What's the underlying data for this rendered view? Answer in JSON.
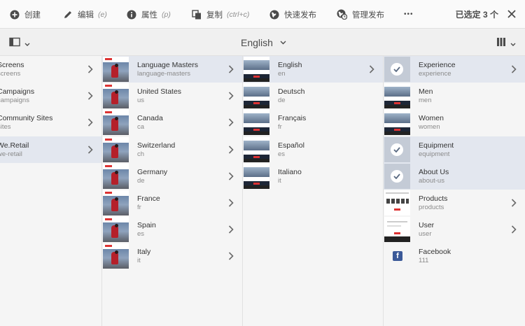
{
  "actionbar": {
    "create_label": "创建",
    "edit_label": "编辑",
    "edit_hint": "(e)",
    "properties_label": "属性",
    "properties_hint": "(p)",
    "copy_label": "复制",
    "copy_hint": "(ctrl+c)",
    "quick_publish_label": "快速发布",
    "manage_publish_label": "管理发布",
    "more_label": "•••",
    "selection_count": "已选定 3 个"
  },
  "titlebar": {
    "title": "English"
  },
  "columns": {
    "col1": [
      {
        "label": "Screens",
        "sub": "screens",
        "active": false
      },
      {
        "label": "Campaigns",
        "sub": "campaigns",
        "active": false
      },
      {
        "label": "Community Sites",
        "sub": "sites",
        "active": false
      },
      {
        "label": "We.Retail",
        "sub": "we-retail",
        "active": true
      }
    ],
    "col2": [
      {
        "label": "Language Masters",
        "sub": "language-masters",
        "active": true
      },
      {
        "label": "United States",
        "sub": "us",
        "active": false
      },
      {
        "label": "Canada",
        "sub": "ca",
        "active": false
      },
      {
        "label": "Switzerland",
        "sub": "ch",
        "active": false
      },
      {
        "label": "Germany",
        "sub": "de",
        "active": false
      },
      {
        "label": "France",
        "sub": "fr",
        "active": false
      },
      {
        "label": "Spain",
        "sub": "es",
        "active": false
      },
      {
        "label": "Italy",
        "sub": "it",
        "active": false
      }
    ],
    "col3": [
      {
        "label": "English",
        "sub": "en",
        "active": true
      },
      {
        "label": "Deutsch",
        "sub": "de",
        "active": false
      },
      {
        "label": "Français",
        "sub": "fr",
        "active": false
      },
      {
        "label": "Español",
        "sub": "es",
        "active": false
      },
      {
        "label": "Italiano",
        "sub": "it",
        "active": false
      }
    ],
    "col4": [
      {
        "label": "Experience",
        "sub": "experience",
        "active": true,
        "selected": true
      },
      {
        "label": "Men",
        "sub": "men",
        "active": false
      },
      {
        "label": "Women",
        "sub": "women",
        "active": false
      },
      {
        "label": "Equipment",
        "sub": "equipment",
        "active": true,
        "selected": true
      },
      {
        "label": "About Us",
        "sub": "about-us",
        "active": true,
        "selected": true
      },
      {
        "label": "Products",
        "sub": "products",
        "active": false
      },
      {
        "label": "User",
        "sub": "user",
        "active": false
      },
      {
        "label": "Facebook",
        "sub": "111",
        "active": false
      }
    ]
  },
  "icons": {
    "create": "add-circle-icon",
    "edit": "pencil-icon",
    "properties": "info-icon",
    "copy": "copy-icon",
    "quick_publish": "globe-icon",
    "manage_publish": "globe-clock-icon",
    "more": "more-icon",
    "close": "close-icon",
    "rail": "rail-toggle-icon",
    "view": "column-view-icon",
    "chevron": "chevron-right-icon",
    "check": "checkmark-icon",
    "facebook": "facebook-icon"
  },
  "colors": {
    "active_row": "#e3e7ef",
    "background": "#f5f5f5",
    "accent_red": "#d33333",
    "facebook_blue": "#3b5998"
  }
}
